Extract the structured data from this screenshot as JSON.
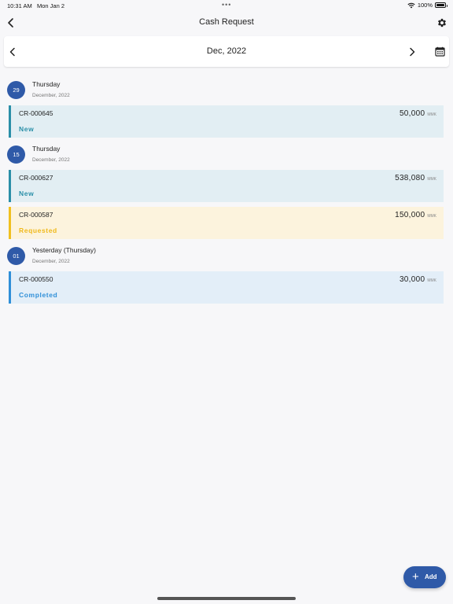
{
  "status_bar": {
    "time": "10:31 AM",
    "date": "Mon Jan 2",
    "dots": "•••",
    "battery": "100%"
  },
  "nav": {
    "title": "Cash Request"
  },
  "month_selector": {
    "label": "Dec, 2022"
  },
  "groups": [
    {
      "day": "29",
      "weekday": "Thursday",
      "month": "December, 2022",
      "requests": [
        {
          "id": "CR-000645",
          "amount": "50,000",
          "unit": "MMK",
          "status": "New"
        }
      ]
    },
    {
      "day": "15",
      "weekday": "Thursday",
      "month": "December, 2022",
      "requests": [
        {
          "id": "CR-000627",
          "amount": "538,080",
          "unit": "MMK",
          "status": "New"
        },
        {
          "id": "CR-000587",
          "amount": "150,000",
          "unit": "MMK",
          "status": "Requested"
        }
      ]
    },
    {
      "day": "01",
      "weekday": "Yesterday (Thursday)",
      "month": "December, 2022",
      "requests": [
        {
          "id": "CR-000550",
          "amount": "30,000",
          "unit": "MMK",
          "status": "Completed"
        }
      ]
    }
  ],
  "fab": {
    "label": "Add",
    "icon": "plus-icon"
  },
  "colors": {
    "primary": "#2f5aa8",
    "new": "#2a8fa8",
    "requested": "#f0b91a",
    "completed": "#2f8fd8"
  }
}
